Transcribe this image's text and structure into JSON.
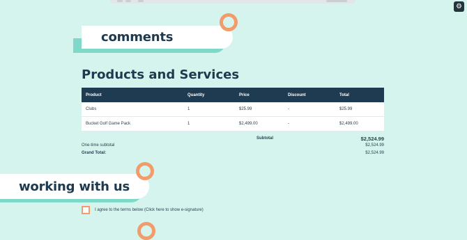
{
  "comments_section": {
    "title": "comments"
  },
  "products": {
    "heading": "Products and Services",
    "columns": [
      "Product",
      "Quantity",
      "Price",
      "Discount",
      "Total"
    ],
    "rows": [
      {
        "product": "Clubs",
        "quantity": "1",
        "price": "$25.99",
        "discount": "-",
        "total": "$25.99"
      },
      {
        "product": "Bucket Golf Game Pack",
        "quantity": "1",
        "price": "$2,499.00",
        "discount": "-",
        "total": "$2,499.00"
      }
    ]
  },
  "totals": {
    "subtotal_label": "Subtotal",
    "subtotal_value": "$2,524.99",
    "one_time_label": "One-time subtotal",
    "one_time_value": "$2,524.99",
    "grand_total_label": "Grand Total:",
    "grand_total_value": "$2,524.99"
  },
  "working_section": {
    "title": "working with us"
  },
  "agreement": {
    "label": "I agree to the terms below (Click here to show e-signature)",
    "checked": false
  },
  "colors": {
    "background": "#d6f4ee",
    "accent_teal": "#7fd8c8",
    "accent_orange": "#f29c6b",
    "header_navy": "#1e3b52"
  },
  "icons": {
    "brand": "hubspot-sprocket-icon"
  }
}
